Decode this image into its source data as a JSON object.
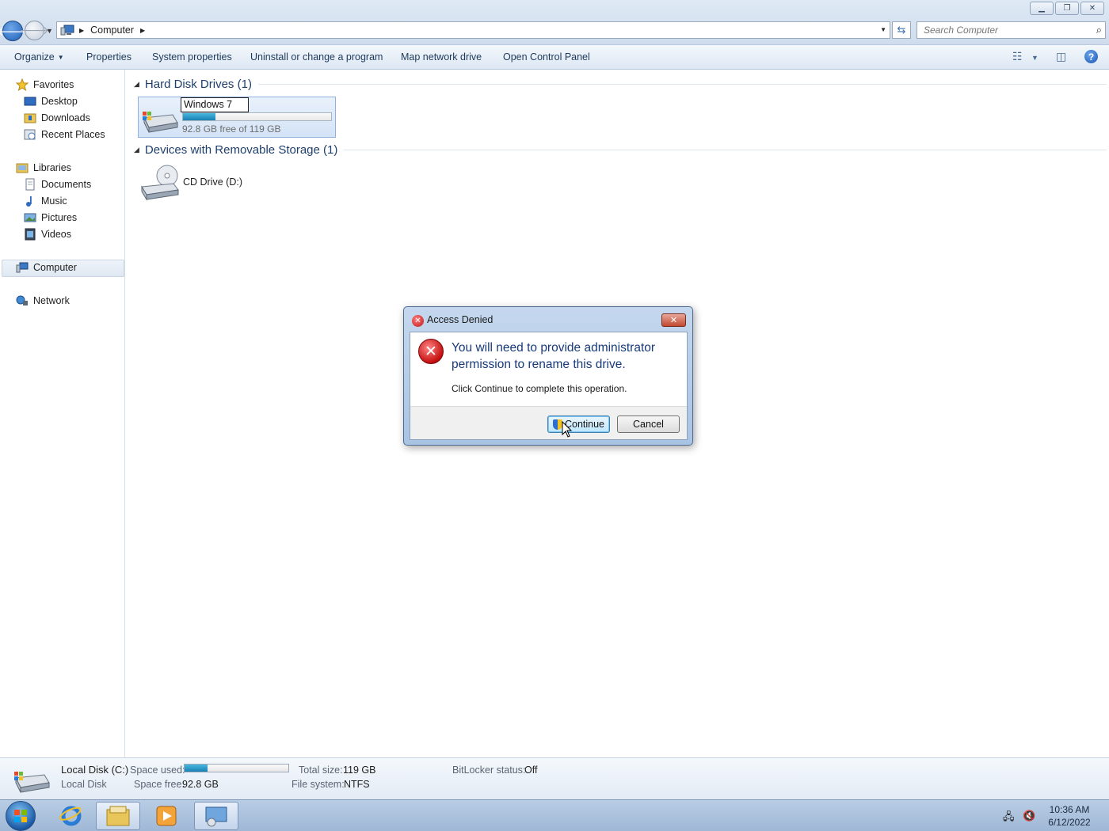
{
  "window": {
    "controls": [
      "minimize",
      "restore",
      "close"
    ]
  },
  "address_bar": {
    "breadcrumb": "Computer",
    "search_placeholder": "Search Computer"
  },
  "toolbar": {
    "items": [
      "Organize",
      "Properties",
      "System properties",
      "Uninstall or change a program",
      "Map network drive",
      "Open Control Panel"
    ]
  },
  "sidebar": {
    "favorites": "Favorites",
    "desktop": "Desktop",
    "downloads": "Downloads",
    "recent_places": "Recent Places",
    "libraries": "Libraries",
    "documents": "Documents",
    "music": "Music",
    "pictures": "Pictures",
    "videos": "Videos",
    "computer": "Computer",
    "network": "Network"
  },
  "content": {
    "hard_disk_group": "Hard Disk Drives (1)",
    "drive_name_edit": "Windows 7",
    "drive_free": "92.8 GB free of 119 GB",
    "drive_used_fraction": 0.22,
    "removable_group": "Devices with Removable Storage (1)",
    "cd_drive": "CD Drive (D:)"
  },
  "details_pane": {
    "name": "Local Disk (C:)",
    "type": "Local Disk",
    "space_used_label": "Space used:",
    "space_free_label": "Space free:",
    "space_free_value": "92.8 GB",
    "total_size_label": "Total size:",
    "total_size_value": "119 GB",
    "file_system_label": "File system:",
    "file_system_value": "NTFS",
    "bitlocker_label": "BitLocker status:",
    "bitlocker_value": "Off",
    "used_fraction": 0.22
  },
  "dialog": {
    "title": "Access Denied",
    "main_instruction": "You will need to provide administrator permission to rename this drive.",
    "content": "Click Continue to complete this operation.",
    "continue_label": "Continue",
    "cancel_label": "Cancel"
  },
  "taskbar": {
    "time": "10:36 AM",
    "date": "6/12/2022"
  },
  "colors": {
    "accent": "#1e3f6e",
    "usage_bar": "#1b7fb2",
    "error_red": "#c50f0f"
  }
}
